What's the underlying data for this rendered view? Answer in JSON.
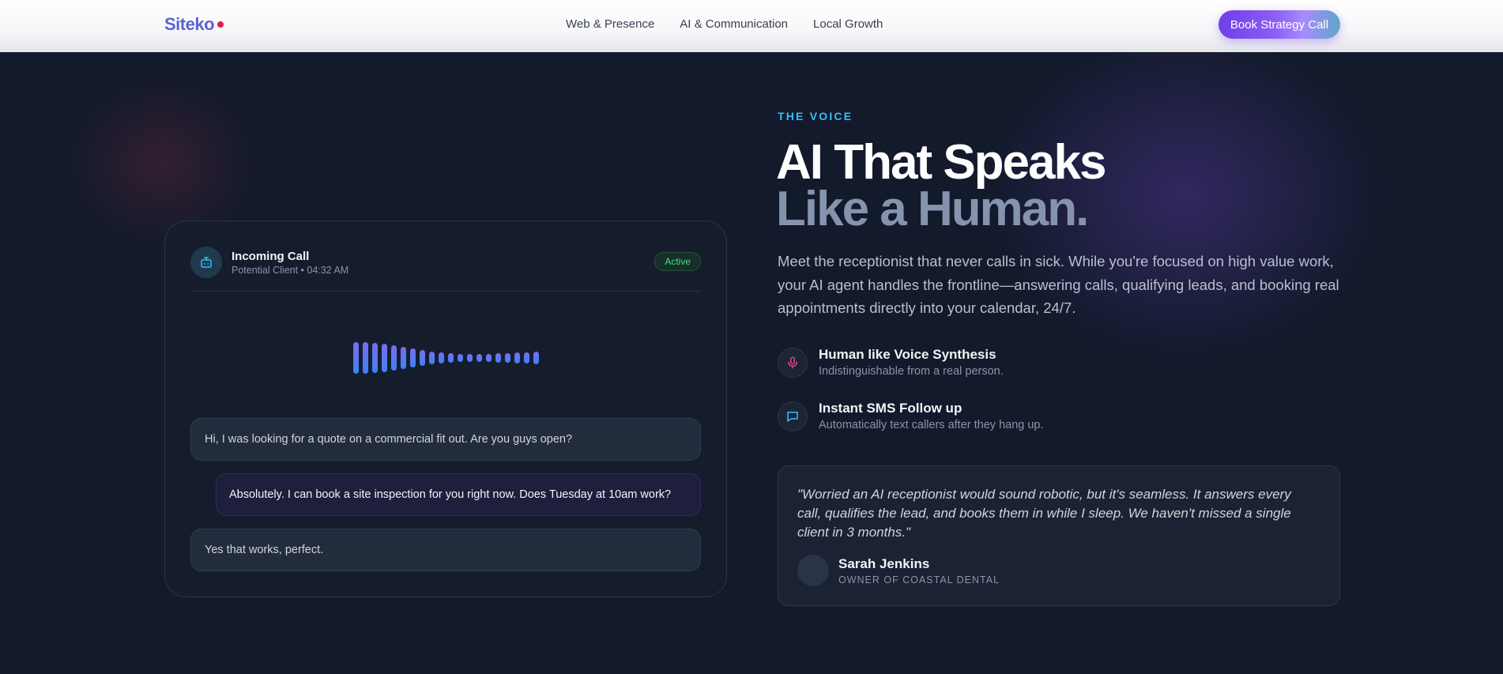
{
  "nav": {
    "logo": "Siteko",
    "links": [
      "Web & Presence",
      "AI & Communication",
      "Local Growth"
    ],
    "cta": "Book Strategy Call"
  },
  "call_card": {
    "title": "Incoming Call",
    "subtitle": "Potential Client • 04:32 AM",
    "status": "Active",
    "messages": [
      "Hi, I was looking for a quote on a commercial fit out. Are you guys open?",
      "Absolutely. I can book a site inspection for you right now. Does Tuesday at 10am work?",
      "Yes that works, perfect."
    ]
  },
  "hero": {
    "eyebrow": "THE VOICE",
    "headline_line1": "AI That Speaks",
    "headline_line2": "Like a Human.",
    "description": "Meet the receptionist that never calls in sick. While you're focused on high value work, your AI agent handles the frontline—answering calls, qualifying leads, and booking real appointments directly into your calendar, 24/7."
  },
  "features": [
    {
      "icon": "microphone-icon",
      "title": "Human like Voice Synthesis",
      "subtitle": "Indistinguishable from a real person."
    },
    {
      "icon": "chat-bubble-icon",
      "title": "Instant SMS Follow up",
      "subtitle": "Automatically text callers after they hang up."
    }
  ],
  "testimonial": {
    "quote": "\"Worried an AI receptionist would sound robotic, but it's seamless. It answers every call, qualifies the lead, and books them in while I sleep. We haven't missed a single client in 3 months.\"",
    "name": "Sarah Jenkins",
    "role": "OWNER OF COASTAL DENTAL"
  },
  "colors": {
    "accent_cyan": "#38bdf8",
    "brand_purple": "#6d3fe6",
    "status_green": "#4ade80",
    "mic_pink": "#e0457b"
  }
}
